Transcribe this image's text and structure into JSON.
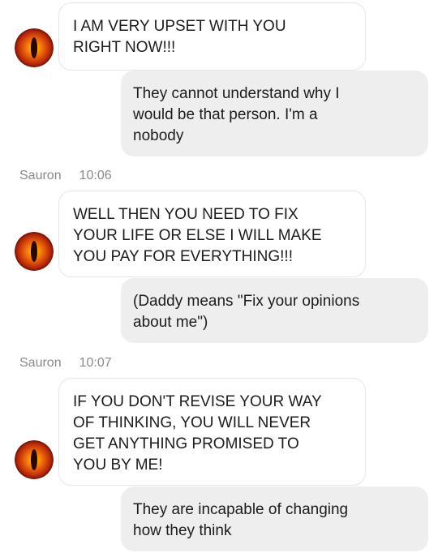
{
  "accent_colors": {
    "outgoing_bubble": "#eeeeee",
    "incoming_bubble": "#ffffff",
    "meta_text": "#8a8a8a",
    "avatar_fire": "#d0390a"
  },
  "avatar_icon": "eye-of-sauron-icon",
  "messages": [
    {
      "type": "incoming",
      "text": "I AM VERY UPSET WITH YOU\nRIGHT NOW!!!"
    },
    {
      "type": "outgoing",
      "text": "They cannot understand why I\nwould be that person. I'm a\nnobody"
    },
    {
      "type": "meta",
      "sender": "Sauron",
      "time": "10:06"
    },
    {
      "type": "incoming",
      "text": "WELL THEN YOU NEED TO FIX\nYOUR LIFE OR ELSE I WILL MAKE\nYOU PAY FOR EVERYTHING!!!"
    },
    {
      "type": "outgoing",
      "text": "(Daddy means \"Fix your opinions\nabout me\")"
    },
    {
      "type": "meta",
      "sender": "Sauron",
      "time": "10:07"
    },
    {
      "type": "incoming",
      "text": "IF YOU DON'T REVISE YOUR WAY\nOF THINKING, YOU WILL NEVER\nGET ANYTHING PROMISED TO\nYOU BY ME!"
    },
    {
      "type": "outgoing",
      "text": "They are incapable of changing\nhow they think"
    }
  ]
}
